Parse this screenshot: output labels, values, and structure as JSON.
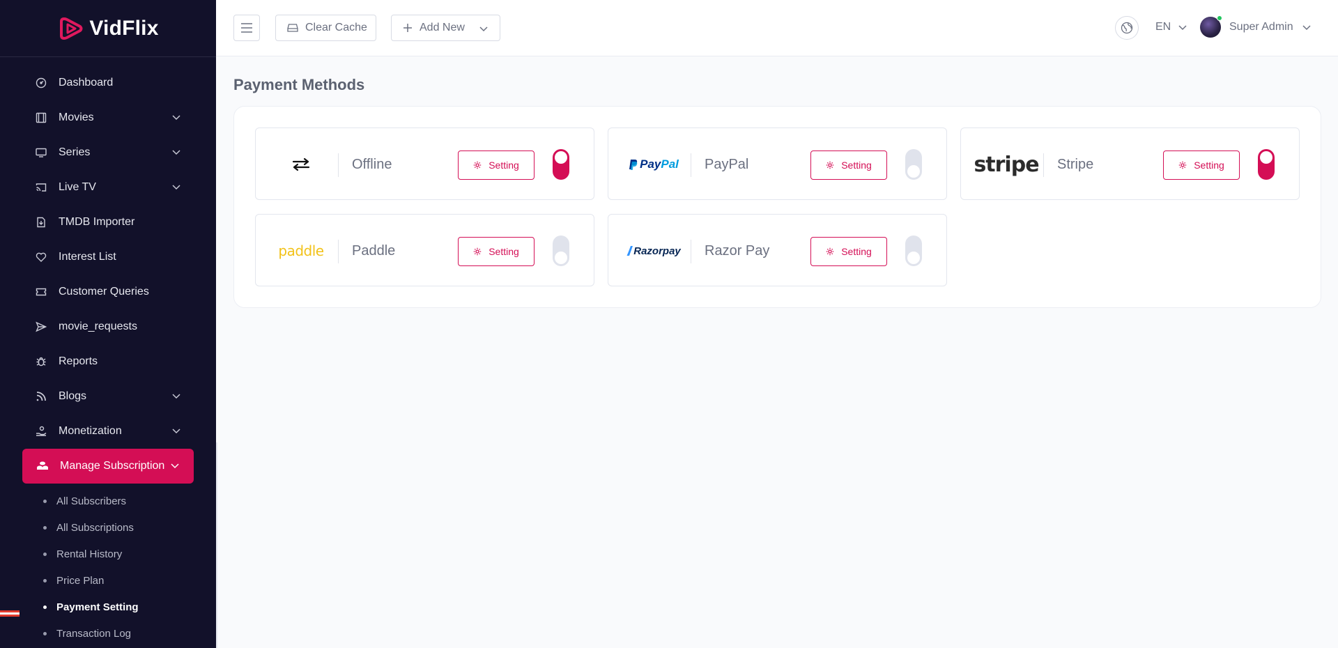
{
  "brand": {
    "name": "VidFlix",
    "accent": "#d40e55",
    "sidebar_bg": "#12112a"
  },
  "sidebar": {
    "items": [
      {
        "label": "Dashboard",
        "icon": "gauge-icon",
        "has_children": false
      },
      {
        "label": "Movies",
        "icon": "film-icon",
        "has_children": true
      },
      {
        "label": "Series",
        "icon": "monitor-icon",
        "has_children": true
      },
      {
        "label": "Live TV",
        "icon": "cast-icon",
        "has_children": true
      },
      {
        "label": "TMDB Importer",
        "icon": "file-import-icon",
        "has_children": false
      },
      {
        "label": "Interest List",
        "icon": "heart-icon",
        "has_children": false
      },
      {
        "label": "Customer Queries",
        "icon": "ticket-icon",
        "has_children": false
      },
      {
        "label": "movie_requests",
        "icon": "send-icon",
        "has_children": false
      },
      {
        "label": "Reports",
        "icon": "bug-icon",
        "has_children": false
      },
      {
        "label": "Blogs",
        "icon": "rss-icon",
        "has_children": true
      },
      {
        "label": "Monetization",
        "icon": "hand-coin-icon",
        "has_children": true
      },
      {
        "label": "Manage Subscription",
        "icon": "coins-icon",
        "has_children": true,
        "active": true
      }
    ],
    "sub_items": [
      {
        "label": "All Subscribers"
      },
      {
        "label": "All Subscriptions"
      },
      {
        "label": "Rental History"
      },
      {
        "label": "Price Plan"
      },
      {
        "label": "Payment Setting",
        "current": true
      },
      {
        "label": "Transaction Log"
      }
    ]
  },
  "topbar": {
    "clear_cache_label": "Clear Cache",
    "add_new_label": "Add New",
    "language": "EN",
    "user_name": "Super Admin"
  },
  "main": {
    "title": "Payment Methods",
    "setting_label": "Setting",
    "methods": [
      {
        "name": "Offline",
        "logo": "offline-transfer-icon",
        "enabled": true
      },
      {
        "name": "PayPal",
        "logo": "paypal-logo",
        "logo_text": "PayPal",
        "enabled": false
      },
      {
        "name": "Stripe",
        "logo": "stripe-logo",
        "logo_text": "stripe",
        "enabled": true
      },
      {
        "name": "Paddle",
        "logo": "paddle-logo",
        "logo_text": "paddle",
        "enabled": false
      },
      {
        "name": "Razor Pay",
        "logo": "razorpay-logo",
        "logo_text": "Razorpay",
        "enabled": false
      }
    ]
  }
}
